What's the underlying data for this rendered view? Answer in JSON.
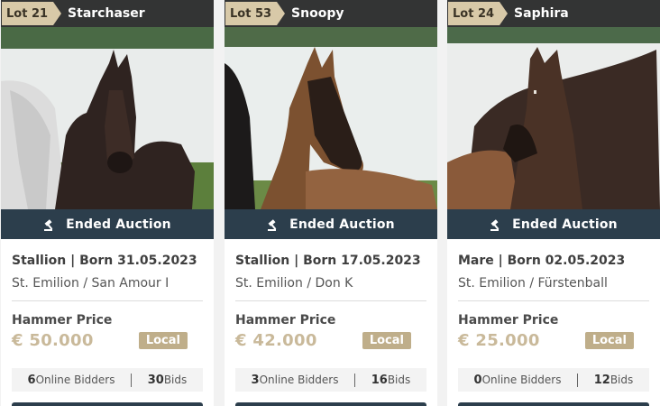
{
  "cards": [
    {
      "lot": "Lot 21",
      "name": "Starchaser",
      "status": "Ended Auction",
      "born": "Stallion | Born 31.05.2023",
      "pedigree": "St. Emilion / San Amour I",
      "hammer_label": "Hammer Price",
      "price": "€ 50.000",
      "badge": "Local",
      "online_count": "6",
      "online_label": "Online Bidders",
      "bid_count": "30",
      "bid_label": "Bids"
    },
    {
      "lot": "Lot 53",
      "name": "Snoopy",
      "status": "Ended Auction",
      "born": "Stallion | Born 17.05.2023",
      "pedigree": "St. Emilion / Don K",
      "hammer_label": "Hammer Price",
      "price": "€ 42.000",
      "badge": "Local",
      "online_count": "3",
      "online_label": "Online Bidders",
      "bid_count": "16",
      "bid_label": "Bids"
    },
    {
      "lot": "Lot 24",
      "name": "Saphira",
      "status": "Ended Auction",
      "born": "Mare | Born 02.05.2023",
      "pedigree": "St. Emilion / Fürstenball",
      "hammer_label": "Hammer Price",
      "price": "€ 25.000",
      "badge": "Local",
      "online_count": "0",
      "online_label": "Online Bidders",
      "bid_count": "12",
      "bid_label": "Bids"
    }
  ],
  "icons": {
    "status": "gavel-icon"
  },
  "colors": {
    "header_bg": "#333434",
    "lot_tag": "#d8c9a8",
    "status_bar": "#2c3e4c",
    "price": "#c9b99a",
    "badge": "#bfae8a"
  }
}
